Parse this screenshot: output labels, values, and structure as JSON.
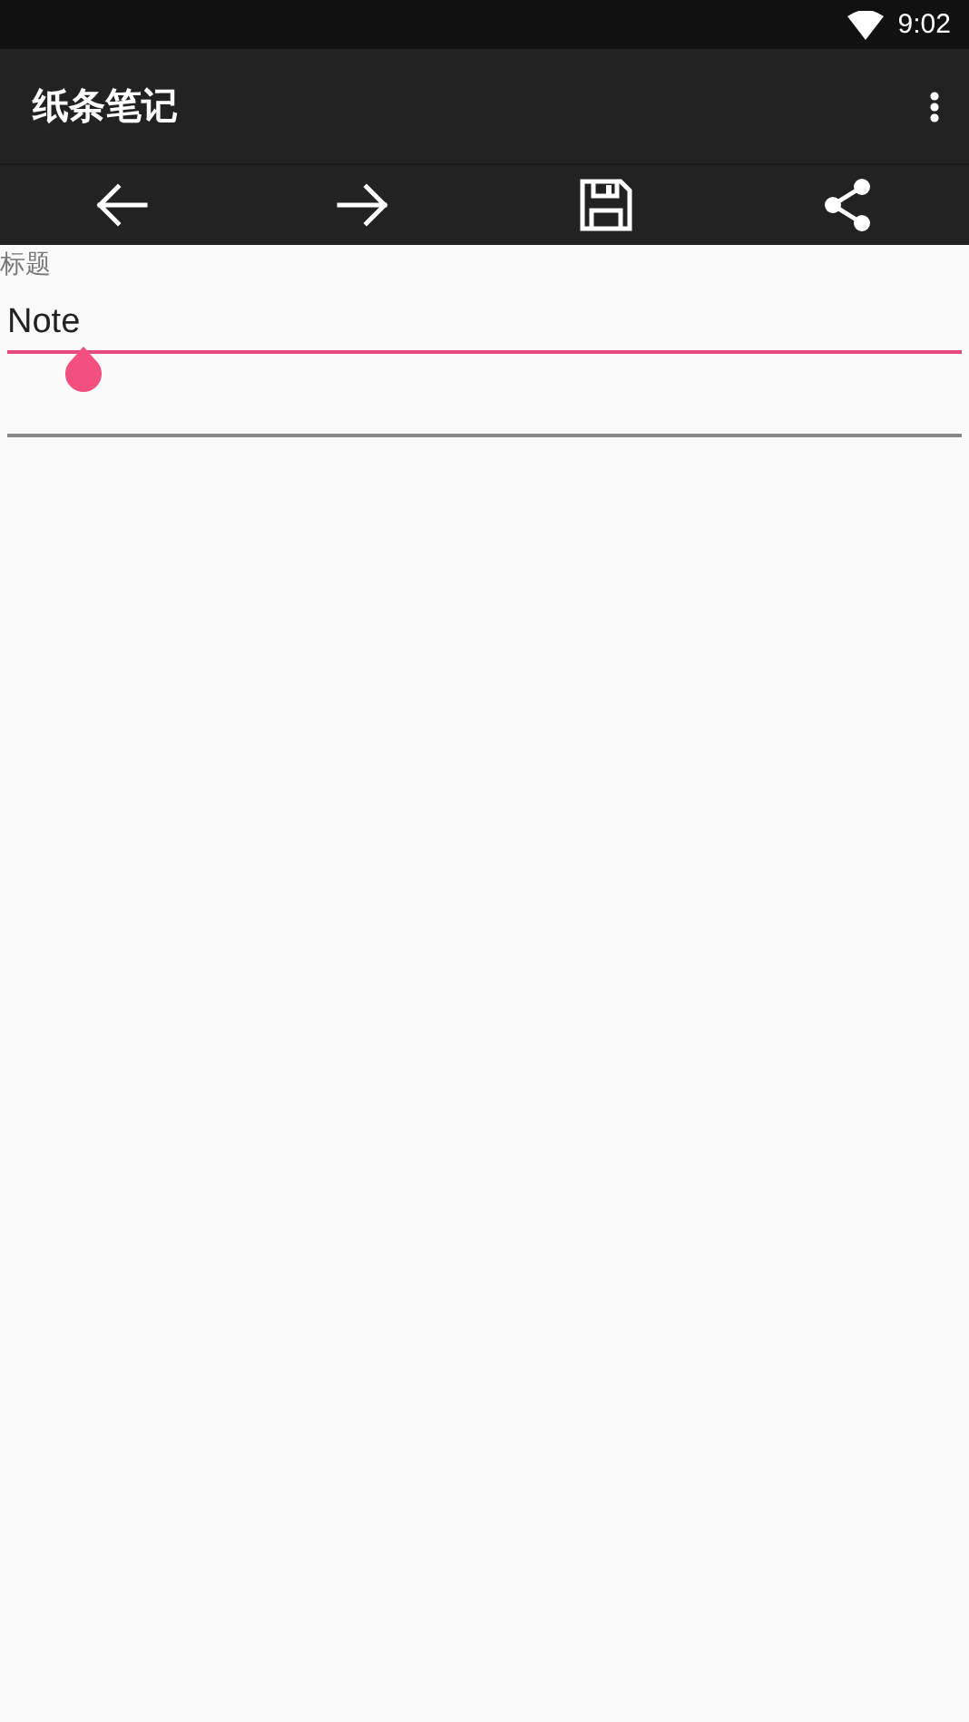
{
  "status_bar": {
    "time": "9:02"
  },
  "app_bar": {
    "title": "纸条笔记"
  },
  "toolbar": {
    "buttons": [
      {
        "kind": "back"
      },
      {
        "kind": "forward"
      },
      {
        "kind": "save"
      },
      {
        "kind": "share"
      }
    ]
  },
  "title_field": {
    "label": "标题",
    "value": "Note",
    "focused": true
  },
  "body_field": {
    "focused": false
  }
}
